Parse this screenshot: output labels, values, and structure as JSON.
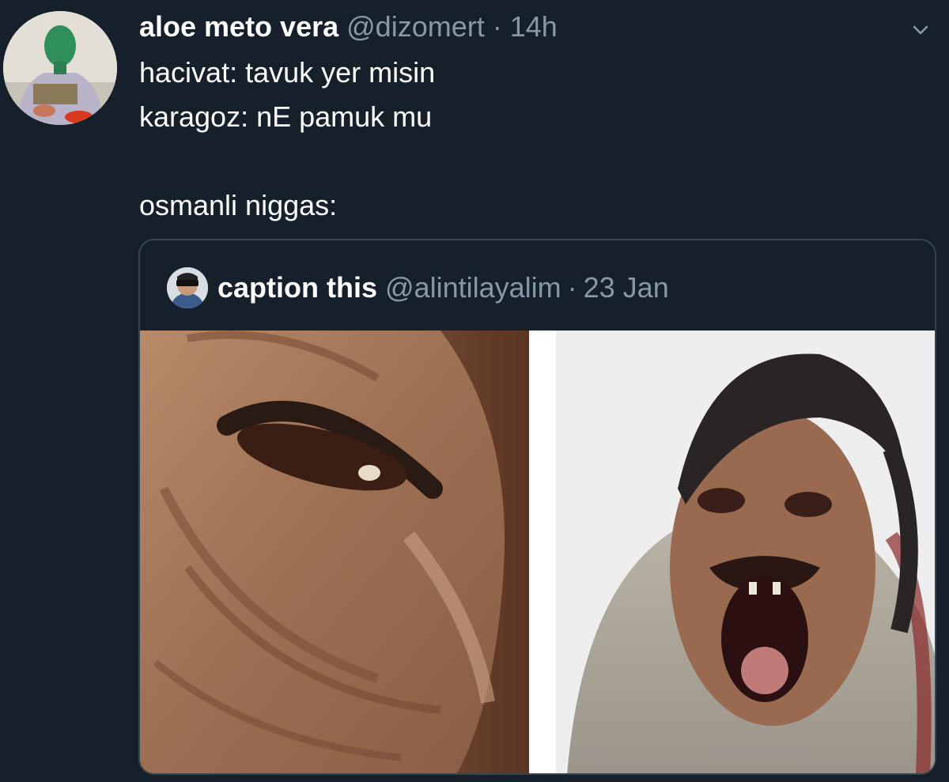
{
  "tweet": {
    "display_name": "aloe meto vera",
    "handle": "@dizomert",
    "separator": "·",
    "time": "14h",
    "lines": [
      "hacivat: tavuk yer misin",
      "karagoz: nE pamuk mu",
      "",
      "osmanli niggas:"
    ],
    "avatar_icon": "profile-photo",
    "menu_icon": "chevron-down-icon"
  },
  "quoted_tweet": {
    "display_name": "caption this",
    "handle": "@alintilayalim",
    "separator": "·",
    "date": "23 Jan",
    "avatar_icon": "profile-photo",
    "media": [
      {
        "description": "stretched laughing face close-up"
      },
      {
        "description": "stretched laughing man in sweater"
      }
    ]
  },
  "colors": {
    "background": "#15202b",
    "text_primary": "#ffffff",
    "text_secondary": "#8899a6",
    "border": "#38444d"
  }
}
